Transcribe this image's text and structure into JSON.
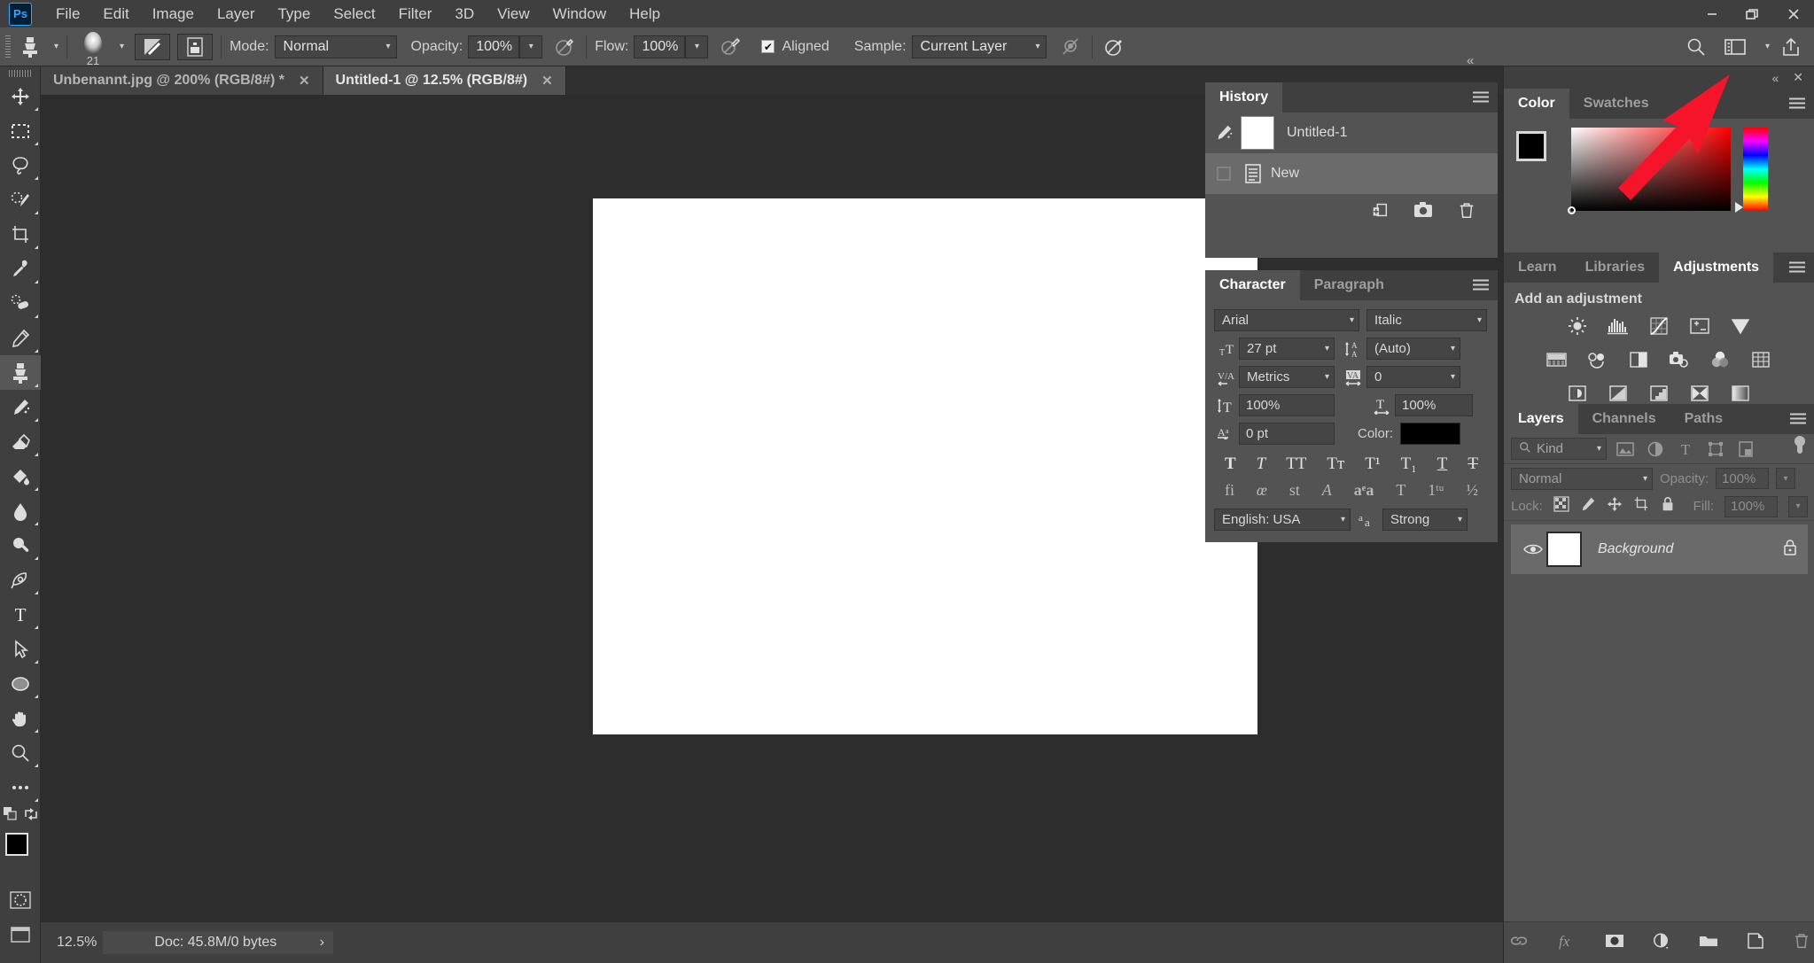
{
  "app": {
    "logo_text": "Ps"
  },
  "menubar": {
    "items": [
      "File",
      "Edit",
      "Image",
      "Layer",
      "Type",
      "Select",
      "Filter",
      "3D",
      "View",
      "Window",
      "Help"
    ],
    "window_controls": {
      "minimize": "—",
      "restore": "❐",
      "close": "✕"
    }
  },
  "options_bar": {
    "tool_icon": "clone-stamp",
    "brush_size": "21",
    "mode_label": "Mode:",
    "mode_value": "Normal",
    "opacity_label": "Opacity:",
    "opacity_value": "100%",
    "flow_label": "Flow:",
    "flow_value": "100%",
    "aligned_label": "Aligned",
    "aligned_checked": "✔",
    "sample_label": "Sample:",
    "sample_value": "Current Layer"
  },
  "right_top_icons": {
    "search": "search-icon",
    "workspace": "workspace-icon",
    "share": "share-icon"
  },
  "tabs": [
    {
      "title": "Unbenannt.jpg @ 200% (RGB/8#) *",
      "close": "✕",
      "active": false
    },
    {
      "title": "Untitled-1 @ 12.5% (RGB/8#)",
      "close": "✕",
      "active": true
    }
  ],
  "toolbar": {
    "tools": [
      {
        "name": "move-tool",
        "active": false
      },
      {
        "name": "rectangular-marquee-tool",
        "active": false
      },
      {
        "name": "lasso-tool",
        "active": false
      },
      {
        "name": "quick-selection-tool",
        "active": false
      },
      {
        "name": "crop-tool",
        "active": false
      },
      {
        "name": "eyedropper-tool",
        "active": false
      },
      {
        "name": "spot-healing-brush-tool",
        "active": false
      },
      {
        "name": "brush-tool",
        "active": false
      },
      {
        "name": "clone-stamp-tool",
        "active": true
      },
      {
        "name": "history-brush-tool",
        "active": false
      },
      {
        "name": "eraser-tool",
        "active": false
      },
      {
        "name": "gradient-tool",
        "active": false
      },
      {
        "name": "blur-tool",
        "active": false
      },
      {
        "name": "dodge-tool",
        "active": false
      },
      {
        "name": "pen-tool",
        "active": false
      },
      {
        "name": "horizontal-type-tool",
        "active": false
      },
      {
        "name": "path-selection-tool",
        "active": false
      },
      {
        "name": "ellipse-tool",
        "active": false
      },
      {
        "name": "hand-tool",
        "active": false
      },
      {
        "name": "zoom-tool",
        "active": false
      },
      {
        "name": "edit-toolbar-tool",
        "active": false
      }
    ],
    "foreground_color": "#000000",
    "background_color": "#ffffff"
  },
  "status_bar": {
    "zoom": "12.5%",
    "doc_info": "Doc: 45.8M/0 bytes",
    "expand": "›"
  },
  "history_panel": {
    "tabs": [
      {
        "label": "History",
        "active": true
      }
    ],
    "rows": [
      {
        "label": "Untitled-1",
        "selected": false,
        "type": "snapshot"
      },
      {
        "label": "New",
        "selected": true,
        "type": "state"
      }
    ],
    "footer_icons": [
      "create-document-from-state-icon",
      "create-snapshot-icon",
      "delete-state-icon"
    ]
  },
  "character_panel": {
    "tabs": [
      {
        "label": "Character",
        "active": true
      },
      {
        "label": "Paragraph",
        "active": false
      }
    ],
    "font_family": "Arial",
    "font_style": "Italic",
    "font_size": "27 pt",
    "leading": "(Auto)",
    "kerning": "Metrics",
    "tracking": "0",
    "vertical_scale": "100%",
    "horizontal_scale": "100%",
    "baseline_shift": "0 pt",
    "color_label": "Color:",
    "text_color": "#000000",
    "style_buttons": [
      "T",
      "T",
      "TT",
      "Tt",
      "T¹",
      "T₁",
      "T",
      "T"
    ],
    "opentype_buttons": [
      "fi",
      "œ",
      "st",
      "ᴀ",
      "aa",
      "T",
      "1st",
      "½"
    ],
    "language": "English: USA",
    "antialias": "Strong"
  },
  "color_panel": {
    "tabs": [
      {
        "label": "Color",
        "active": true
      },
      {
        "label": "Swatches",
        "active": false
      }
    ],
    "foreground_color": "#000000",
    "background_color": "#ffffff",
    "ramp_base_color": "#ff0000"
  },
  "adjustments_panel": {
    "tabs": [
      {
        "label": "Learn",
        "active": false
      },
      {
        "label": "Libraries",
        "active": false
      },
      {
        "label": "Adjustments",
        "active": true
      }
    ],
    "title": "Add an adjustment",
    "row1": [
      "brightness-contrast-icon",
      "levels-icon",
      "curves-icon",
      "exposure-icon",
      "vibrance-icon"
    ],
    "row2": [
      "hue-saturation-icon",
      "color-balance-icon",
      "black-white-icon",
      "photo-filter-icon",
      "channel-mixer-icon",
      "color-lookup-icon"
    ],
    "row3": [
      "invert-icon",
      "posterize-icon",
      "threshold-icon",
      "selective-color-icon",
      "gradient-map-icon"
    ]
  },
  "layers_panel": {
    "tabs": [
      {
        "label": "Layers",
        "active": true
      },
      {
        "label": "Channels",
        "active": false
      },
      {
        "label": "Paths",
        "active": false
      }
    ],
    "filter_kind": "Kind",
    "filter_icons": [
      "filter-pixel-icon",
      "filter-adjustment-icon",
      "filter-type-icon",
      "filter-shape-icon",
      "filter-smart-object-icon"
    ],
    "blend_mode": "Normal",
    "opacity_label": "Opacity:",
    "opacity_value": "100%",
    "lock_label": "Lock:",
    "lock_icons": [
      "lock-transparent-pixels-icon",
      "lock-image-pixels-icon",
      "lock-position-icon",
      "lock-artboard-icon",
      "lock-all-icon"
    ],
    "fill_label": "Fill:",
    "fill_value": "100%",
    "layers": [
      {
        "name": "Background",
        "visible": true,
        "locked": true,
        "selected": true
      }
    ],
    "footer_icons": [
      "link-layers-icon",
      "add-layer-style-icon",
      "add-layer-mask-icon",
      "new-adjustment-layer-icon",
      "new-group-icon",
      "new-layer-icon",
      "delete-layer-icon"
    ]
  },
  "canvas": {
    "document_background": "#ffffff"
  },
  "annotation": {
    "arrow_color": "#f5142a",
    "arrow_label": "pointer-arrow"
  },
  "collapse_controls": {
    "left_dock": "«",
    "right_dock": "«",
    "right_close": "✕"
  }
}
